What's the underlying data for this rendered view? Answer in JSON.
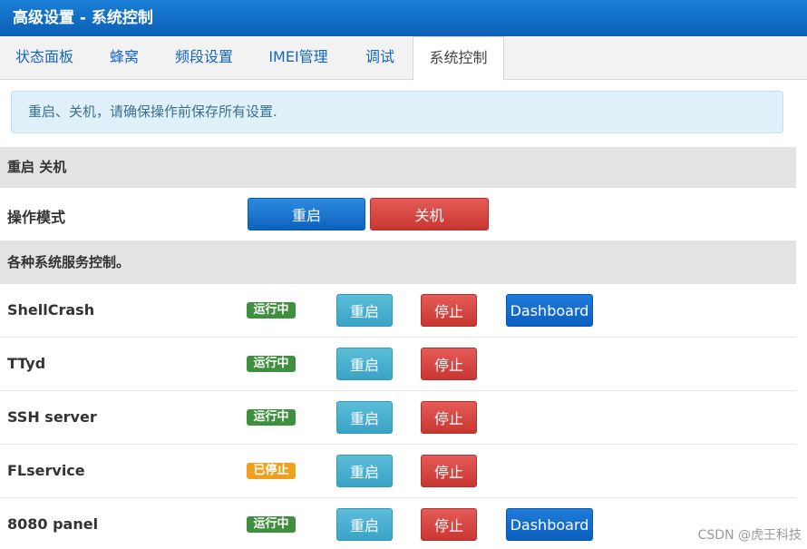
{
  "window": {
    "title": "高级设置 - 系统控制"
  },
  "tabs": [
    {
      "label": "状态面板"
    },
    {
      "label": "蜂窝"
    },
    {
      "label": "频段设置"
    },
    {
      "label": "IMEI管理"
    },
    {
      "label": "调试"
    },
    {
      "label": "系统控制",
      "active": true
    }
  ],
  "notice": "重启、关机，请确保操作前保存所有设置.",
  "power": {
    "section_title": "重启 关机",
    "row_label": "操作模式",
    "reboot_label": "重启",
    "shutdown_label": "关机"
  },
  "services": {
    "section_title": "各种系统服务控制。",
    "restart_label": "重启",
    "stop_label": "停止",
    "dashboard_label": "Dashboard",
    "status_running": "运行中",
    "status_stopped": "已停止",
    "items": [
      {
        "name": "ShellCrash",
        "status": "运行中",
        "has_dashboard": true
      },
      {
        "name": "TTyd",
        "status": "运行中",
        "has_dashboard": false
      },
      {
        "name": "SSH server",
        "status": "运行中",
        "has_dashboard": false
      },
      {
        "name": "FLservice",
        "status": "已停止",
        "has_dashboard": false
      },
      {
        "name": "8080 panel",
        "status": "运行中",
        "has_dashboard": true
      }
    ]
  },
  "watermark": "CSDN @虎王科技",
  "colors": {
    "title_bar": "#0b5fb5",
    "primary": "#0b62bd",
    "danger": "#c93631",
    "info": "#3aa3c6",
    "running": "#3e8f3e",
    "stopped": "#f0a020"
  }
}
